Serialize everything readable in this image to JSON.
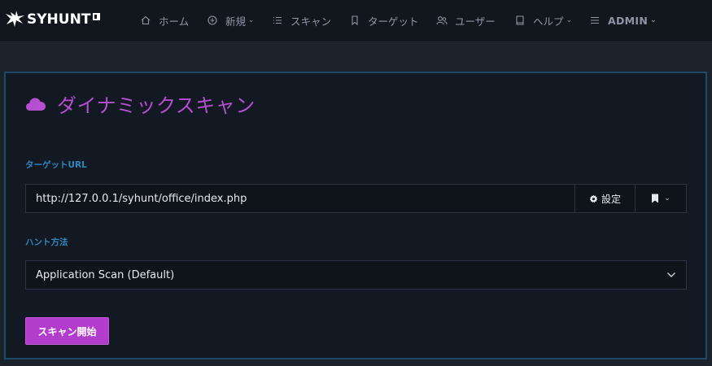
{
  "brand": {
    "name": "SYHUNT"
  },
  "nav": {
    "home": "ホーム",
    "new": "新規",
    "scans": "スキャン",
    "targets": "ターゲット",
    "users": "ユーザー",
    "help": "ヘルプ",
    "admin": "ADMIN"
  },
  "page": {
    "title": "ダイナミックスキャン"
  },
  "form": {
    "target_url_label": "ターゲットURL",
    "target_url_value": "http://127.0.0.1/syhunt/office/index.php",
    "settings_label": "設定",
    "hunt_method_label": "ハント方法",
    "hunt_method_value": "Application Scan (Default)",
    "start_button": "スキャン開始"
  },
  "colors": {
    "accent": "#b23ccc",
    "title": "#b44fd0",
    "label": "#2f86bd",
    "border": "#1d4a68",
    "background": "#1c222c"
  }
}
